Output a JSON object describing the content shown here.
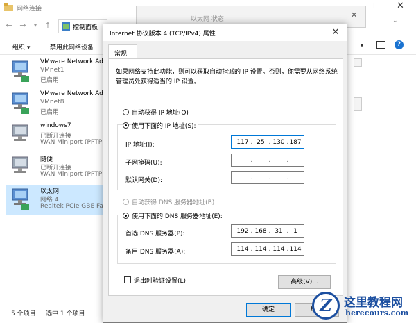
{
  "explorer": {
    "title": "网络连接",
    "address": "控制面板",
    "toolbar": {
      "organize": "组织 ▾",
      "disable": "禁用此网络设备"
    },
    "connections": [
      {
        "name": "VMware Network Ad",
        "sub": "VMnet1",
        "status": "已启用",
        "adapter": ""
      },
      {
        "name": "VMware Network Ad",
        "sub": "VMnet8",
        "status": "已启用",
        "adapter": ""
      },
      {
        "name": "windows7",
        "sub": "已断开连接",
        "status": "WAN Miniport (PPTP",
        "adapter": ""
      },
      {
        "name": "随便",
        "sub": "已断开连接",
        "status": "WAN Miniport (PPTP",
        "adapter": ""
      },
      {
        "name": "以太网",
        "sub": "网络 4",
        "status": "Realtek PCIe GBE Far",
        "adapter": ""
      }
    ],
    "status_items": "5 个项目",
    "status_selected": "选中 1 个项目"
  },
  "midwin": {
    "title": "以太网 状态"
  },
  "dialog": {
    "title": "Internet 协议版本 4 (TCP/IPv4) 属性",
    "close": "✕",
    "tab": "常规",
    "description": "如果网络支持此功能，则可以获取自动指派的 IP 设置。否则，你需要从网络系统管理员处获得适当的 IP 设置。",
    "auto_ip": "自动获得 IP 地址(O)",
    "manual_ip": "使用下面的 IP 地址(S):",
    "ip_label": "IP 地址(I):",
    "ip_value": [
      "117",
      "25",
      "130",
      "187"
    ],
    "mask_label": "子网掩码(U):",
    "gateway_label": "默认网关(D):",
    "auto_dns": "自动获得 DNS 服务器地址(B)",
    "manual_dns": "使用下面的 DNS 服务器地址(E):",
    "dns1_label": "首选 DNS 服务器(P):",
    "dns1_value": [
      "192",
      "168",
      "31",
      "1"
    ],
    "dns2_label": "备用 DNS 服务器(A):",
    "dns2_value": [
      "114",
      "114",
      "114",
      "114"
    ],
    "validate": "退出时验证设置(L)",
    "advanced": "高级(V)...",
    "ok": "确定",
    "cancel": "取消"
  },
  "watermark": {
    "cn": "这里教程网",
    "en": "herecours.com"
  },
  "colors": {
    "selection": "#cce8ff",
    "accent": "#0078d7",
    "watermark": "#1c4fa0"
  }
}
